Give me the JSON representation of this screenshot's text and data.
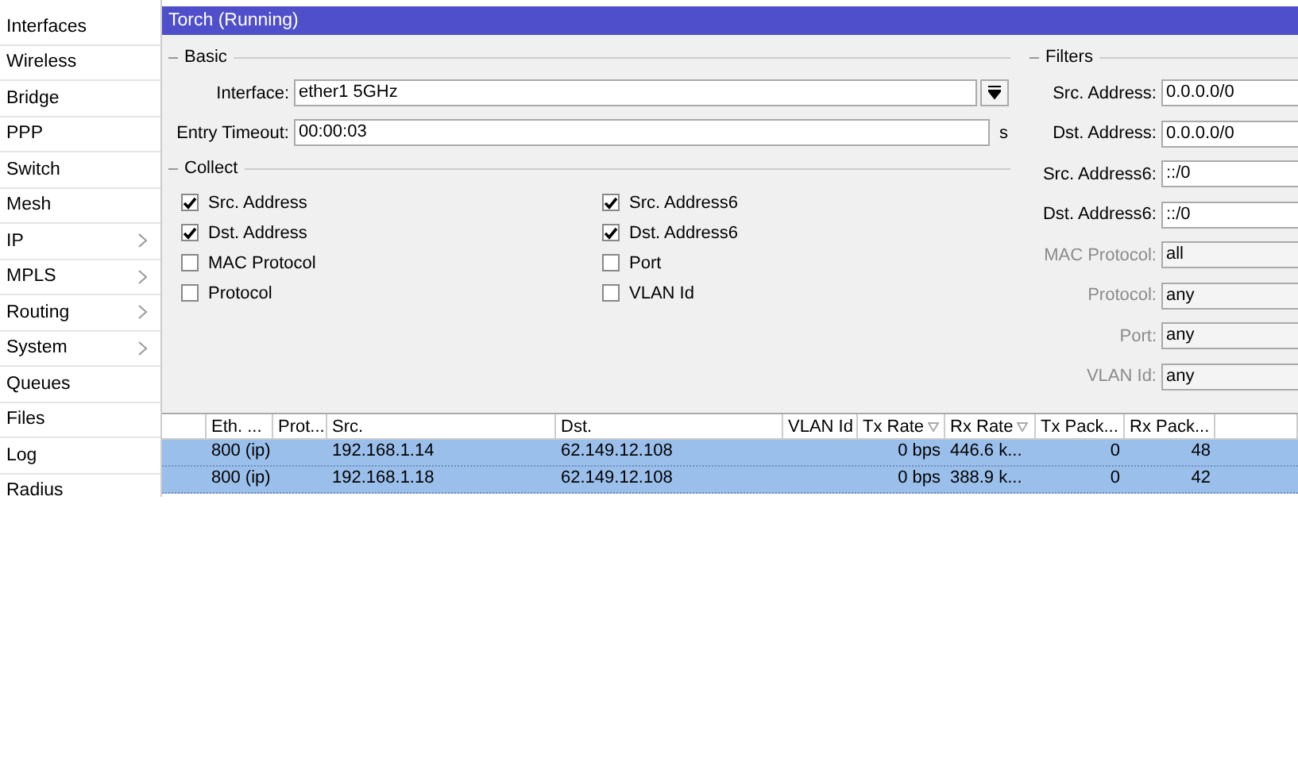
{
  "sidebar": {
    "items": [
      {
        "label": "Interfaces",
        "has_submenu": false
      },
      {
        "label": "Wireless",
        "has_submenu": false
      },
      {
        "label": "Bridge",
        "has_submenu": false
      },
      {
        "label": "PPP",
        "has_submenu": false
      },
      {
        "label": "Switch",
        "has_submenu": false
      },
      {
        "label": "Mesh",
        "has_submenu": false
      },
      {
        "label": "IP",
        "has_submenu": true
      },
      {
        "label": "MPLS",
        "has_submenu": true
      },
      {
        "label": "Routing",
        "has_submenu": true
      },
      {
        "label": "System",
        "has_submenu": true
      },
      {
        "label": "Queues",
        "has_submenu": false
      },
      {
        "label": "Files",
        "has_submenu": false
      },
      {
        "label": "Log",
        "has_submenu": false
      },
      {
        "label": "Radius",
        "has_submenu": false
      }
    ]
  },
  "window": {
    "title": "Torch (Running)"
  },
  "basic": {
    "title": "Basic",
    "interface": {
      "label": "Interface:",
      "value": "ether1 5GHz"
    },
    "entry_timeout": {
      "label": "Entry Timeout:",
      "value": "00:00:03",
      "unit": "s"
    }
  },
  "collect": {
    "title": "Collect",
    "options": [
      {
        "label": "Src. Address",
        "checked": true
      },
      {
        "label": "Dst. Address",
        "checked": true
      },
      {
        "label": "MAC Protocol",
        "checked": false
      },
      {
        "label": "Protocol",
        "checked": false
      },
      {
        "label": "Src. Address6",
        "checked": true
      },
      {
        "label": "Dst. Address6",
        "checked": true
      },
      {
        "label": "Port",
        "checked": false
      },
      {
        "label": "VLAN Id",
        "checked": false
      }
    ]
  },
  "filters": {
    "title": "Filters",
    "fields": [
      {
        "label": "Src. Address:",
        "value": "0.0.0.0/0",
        "disabled": false
      },
      {
        "label": "Dst. Address:",
        "value": "0.0.0.0/0",
        "disabled": false
      },
      {
        "label": "Src. Address6:",
        "value": "::/0",
        "disabled": false
      },
      {
        "label": "Dst. Address6:",
        "value": "::/0",
        "disabled": false
      },
      {
        "label": "MAC Protocol:",
        "value": "all",
        "disabled": true
      },
      {
        "label": "Protocol:",
        "value": "any",
        "disabled": true
      },
      {
        "label": "Port:",
        "value": "any",
        "disabled": true
      },
      {
        "label": "VLAN Id:",
        "value": "any",
        "disabled": true
      }
    ]
  },
  "table": {
    "columns": [
      {
        "label": "Eth. ...",
        "sorted": false
      },
      {
        "label": "Prot...",
        "sorted": false
      },
      {
        "label": "Src.",
        "sorted": false
      },
      {
        "label": "Dst.",
        "sorted": false
      },
      {
        "label": "VLAN Id",
        "sorted": false
      },
      {
        "label": "Tx Rate",
        "sorted": true
      },
      {
        "label": "Rx Rate",
        "sorted": true
      },
      {
        "label": "Tx Pack...",
        "sorted": false
      },
      {
        "label": "Rx Pack...",
        "sorted": false
      }
    ],
    "rows": [
      {
        "selected": true,
        "cells": [
          "800 (ip)",
          "",
          "192.168.1.14",
          "62.149.12.108",
          "",
          "0 bps",
          "446.6 k...",
          "0",
          "48"
        ]
      },
      {
        "selected": true,
        "cells": [
          "800 (ip)",
          "",
          "192.168.1.18",
          "62.149.12.108",
          "",
          "0 bps",
          "388.9 k...",
          "0",
          "42"
        ]
      }
    ]
  }
}
